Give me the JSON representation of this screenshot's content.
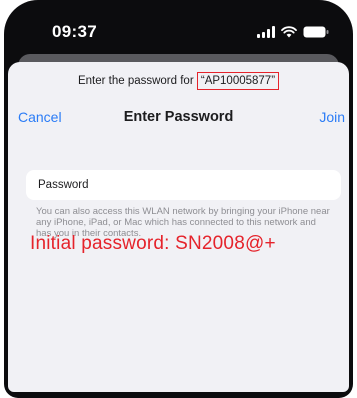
{
  "status_bar": {
    "time": "09:37",
    "icons": [
      "cellular-signal-icon",
      "wifi-icon",
      "battery-icon"
    ]
  },
  "prompt": {
    "text": "Enter the password for",
    "network_name": "“AP10005877”"
  },
  "nav": {
    "cancel_label": "Cancel",
    "title": "Enter Password",
    "join_label": "Join"
  },
  "password_field": {
    "label": "Password",
    "value": ""
  },
  "footnote": "You can also access this WLAN network by bringing your iPhone near any iPhone, iPad, or Mac which has connected to this network and has you in their contacts.",
  "annotation": "Initial password: SN2008@+",
  "colors": {
    "accent": "#2b7cf6",
    "annotation_red": "#e5232b",
    "sheet_background": "#f1f1f5",
    "device_frame": "#0c0c0e"
  }
}
